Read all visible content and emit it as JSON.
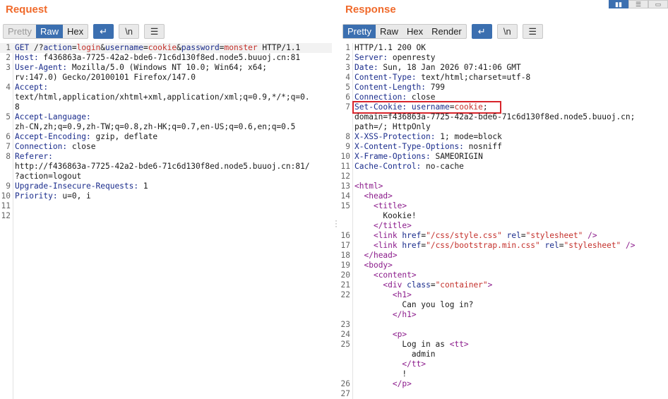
{
  "request": {
    "title": "Request",
    "tabs": [
      "Pretty",
      "Raw",
      "Hex"
    ],
    "active_tab": "Raw",
    "lines": [
      {
        "n": "1",
        "html": "<span class=\"k\">GET</span> /?<span class=\"k\">action</span>=<span class=\"v\">login</span>&amp;<span class=\"k\">username</span>=<span class=\"v\">cookie</span>&amp;<span class=\"k\">password</span>=<span class=\"v\">monster</span> HTTP/1.1"
      },
      {
        "n": "2",
        "html": "<span class=\"k\">Host:</span> f436863a-7725-42a2-bde6-71c6d130f8ed.node5.buuoj.cn:81"
      },
      {
        "n": "3",
        "html": "<span class=\"k\">User-Agent:</span> Mozilla/5.0 (Windows NT 10.0; Win64; x64;"
      },
      {
        "n": "",
        "html": "rv:147.0) Gecko/20100101 Firefox/147.0"
      },
      {
        "n": "4",
        "html": "<span class=\"k\">Accept:</span>"
      },
      {
        "n": "",
        "html": "text/html,application/xhtml+xml,application/xml;q=0.9,*/*;q=0."
      },
      {
        "n": "",
        "html": "8"
      },
      {
        "n": "5",
        "html": "<span class=\"k\">Accept-Language:</span>"
      },
      {
        "n": "",
        "html": "zh-CN,zh;q=0.9,zh-TW;q=0.8,zh-HK;q=0.7,en-US;q=0.6,en;q=0.5"
      },
      {
        "n": "6",
        "html": "<span class=\"k\">Accept-Encoding:</span> gzip, deflate"
      },
      {
        "n": "7",
        "html": "<span class=\"k\">Connection:</span> close"
      },
      {
        "n": "8",
        "html": "<span class=\"k\">Referer:</span>"
      },
      {
        "n": "",
        "html": "http://f436863a-7725-42a2-bde6-71c6d130f8ed.node5.buuoj.cn:81/"
      },
      {
        "n": "",
        "html": "?action=logout"
      },
      {
        "n": "9",
        "html": "<span class=\"k\">Upgrade-Insecure-Requests:</span> 1"
      },
      {
        "n": "10",
        "html": "<span class=\"k\">Priority:</span> u=0, i"
      },
      {
        "n": "11",
        "html": ""
      },
      {
        "n": "12",
        "html": ""
      }
    ]
  },
  "response": {
    "title": "Response",
    "tabs": [
      "Pretty",
      "Raw",
      "Hex",
      "Render"
    ],
    "active_tab": "Pretty",
    "lines": [
      {
        "n": "1",
        "html": "HTTP/1.1 200 OK"
      },
      {
        "n": "2",
        "html": "<span class=\"k\">Server:</span> openresty"
      },
      {
        "n": "3",
        "html": "<span class=\"k\">Date:</span> Sun, 18 Jan 2026 07:41:06 GMT"
      },
      {
        "n": "4",
        "html": "<span class=\"k\">Content-Type:</span> text/html;charset=utf-8"
      },
      {
        "n": "5",
        "html": "<span class=\"k\">Content-Length:</span> 799"
      },
      {
        "n": "6",
        "html": "<span class=\"k\">Connection:</span> close"
      },
      {
        "n": "7",
        "html": "<span class=\"k\">Set-Cookie:</span> <span class=\"k\">username</span>=<span class=\"v\">cookie</span>;"
      },
      {
        "n": "",
        "html": "domain=f436863a-7725-42a2-bde6-71c6d130f8ed.node5.buuoj.cn;"
      },
      {
        "n": "",
        "html": "path=/; HttpOnly"
      },
      {
        "n": "8",
        "html": "<span class=\"k\">X-XSS-Protection:</span> 1; mode=block"
      },
      {
        "n": "9",
        "html": "<span class=\"k\">X-Content-Type-Options:</span> nosniff"
      },
      {
        "n": "10",
        "html": "<span class=\"k\">X-Frame-Options:</span> SAMEORIGIN"
      },
      {
        "n": "11",
        "html": "<span class=\"k\">Cache-Control:</span> no-cache"
      },
      {
        "n": "12",
        "html": ""
      },
      {
        "n": "13",
        "html": "<span class=\"tag\">&lt;html&gt;</span>"
      },
      {
        "n": "14",
        "html": "  <span class=\"tag\">&lt;head&gt;</span>"
      },
      {
        "n": "15",
        "html": "    <span class=\"tag\">&lt;title&gt;</span>"
      },
      {
        "n": "",
        "html": "      Kookie!"
      },
      {
        "n": "",
        "html": "    <span class=\"tag\">&lt;/title&gt;</span>"
      },
      {
        "n": "16",
        "html": "    <span class=\"tag\">&lt;link</span> <span class=\"attr\">href</span>=<span class=\"str\">\"/css/style.css\"</span> <span class=\"attr\">rel</span>=<span class=\"str\">\"stylesheet\"</span> <span class=\"tag\">/&gt;</span>"
      },
      {
        "n": "17",
        "html": "    <span class=\"tag\">&lt;link</span> <span class=\"attr\">href</span>=<span class=\"str\">\"/css/bootstrap.min.css\"</span> <span class=\"attr\">rel</span>=<span class=\"str\">\"stylesheet\"</span> <span class=\"tag\">/&gt;</span>"
      },
      {
        "n": "18",
        "html": "  <span class=\"tag\">&lt;/head&gt;</span>"
      },
      {
        "n": "19",
        "html": "  <span class=\"tag\">&lt;body&gt;</span>"
      },
      {
        "n": "20",
        "html": "    <span class=\"tag\">&lt;content&gt;</span>"
      },
      {
        "n": "21",
        "html": "      <span class=\"tag\">&lt;div</span> <span class=\"attr\">class</span>=<span class=\"str\">\"container\"</span><span class=\"tag\">&gt;</span>"
      },
      {
        "n": "22",
        "html": "        <span class=\"tag\">&lt;h1&gt;</span>"
      },
      {
        "n": "",
        "html": "          Can you log in?"
      },
      {
        "n": "",
        "html": "        <span class=\"tag\">&lt;/h1&gt;</span>"
      },
      {
        "n": "23",
        "html": ""
      },
      {
        "n": "24",
        "html": "        <span class=\"tag\">&lt;p&gt;</span>"
      },
      {
        "n": "25",
        "html": "          Log in as <span class=\"tag\">&lt;tt&gt;</span>"
      },
      {
        "n": "",
        "html": "            admin"
      },
      {
        "n": "",
        "html": "          <span class=\"tag\">&lt;/tt&gt;</span>"
      },
      {
        "n": "",
        "html": "          !"
      },
      {
        "n": "26",
        "html": "        <span class=\"tag\">&lt;/p&gt;</span>"
      },
      {
        "n": "27",
        "html": ""
      }
    ]
  },
  "icons": {
    "wrap": "wrap-lines-icon",
    "newline": "show-newlines-icon",
    "menu": "hamburger-menu-icon"
  },
  "colors": {
    "title": "#f06a2b",
    "active_tab": "#3b6fb0",
    "highlight": "#d8242b"
  }
}
